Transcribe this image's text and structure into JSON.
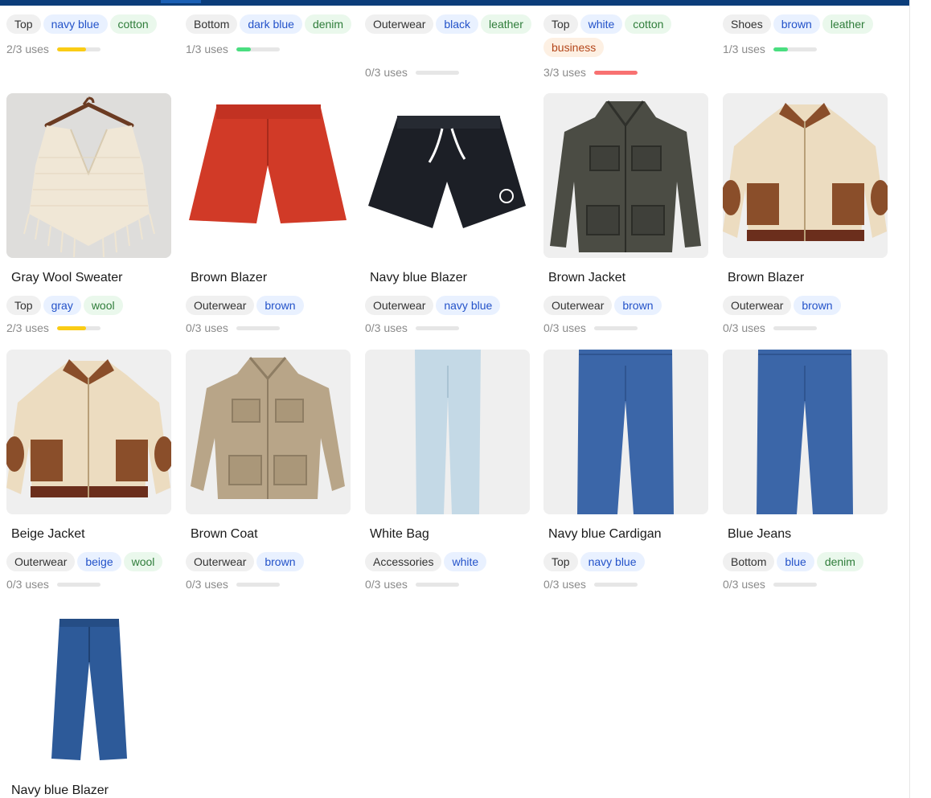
{
  "colors": {
    "bar_empty": "#e6e6e6",
    "bar_one": "#4ade80",
    "bar_two": "#facc15",
    "bar_full": "#f87171"
  },
  "top_row": [
    {
      "tags": [
        {
          "text": "Top",
          "kind": "cat"
        },
        {
          "text": "navy blue",
          "kind": "color"
        },
        {
          "text": "cotton",
          "kind": "mat"
        }
      ],
      "uses": "2/3 uses",
      "used": 2
    },
    {
      "tags": [
        {
          "text": "Bottom",
          "kind": "cat"
        },
        {
          "text": "dark blue",
          "kind": "color"
        },
        {
          "text": "denim",
          "kind": "mat"
        }
      ],
      "uses": "1/3 uses",
      "used": 1
    },
    {
      "tags": [
        {
          "text": "Outerwear",
          "kind": "cat"
        },
        {
          "text": "black",
          "kind": "color"
        },
        {
          "text": "leather",
          "kind": "mat"
        }
      ],
      "uses": "0/3 uses",
      "used": 0
    },
    {
      "tags": [
        {
          "text": "Top",
          "kind": "cat"
        },
        {
          "text": "white",
          "kind": "color"
        },
        {
          "text": "cotton",
          "kind": "mat"
        },
        {
          "text": "business",
          "kind": "occ"
        }
      ],
      "uses": "3/3 uses",
      "used": 3
    },
    {
      "tags": [
        {
          "text": "Shoes",
          "kind": "cat"
        },
        {
          "text": "brown",
          "kind": "color"
        },
        {
          "text": "leather",
          "kind": "mat"
        }
      ],
      "uses": "1/3 uses",
      "used": 1
    }
  ],
  "items": [
    {
      "name": "Gray Wool Sweater",
      "image": "cream-knit-poncho-image",
      "tags": [
        {
          "text": "Top",
          "kind": "cat"
        },
        {
          "text": "gray",
          "kind": "color"
        },
        {
          "text": "wool",
          "kind": "mat"
        }
      ],
      "uses": "2/3 uses",
      "used": 2
    },
    {
      "name": "Brown Blazer",
      "image": "red-shorts-image",
      "tags": [
        {
          "text": "Outerwear",
          "kind": "cat"
        },
        {
          "text": "brown",
          "kind": "color"
        }
      ],
      "uses": "0/3 uses",
      "used": 0
    },
    {
      "name": "Navy blue Blazer",
      "image": "black-shorts-image",
      "tags": [
        {
          "text": "Outerwear",
          "kind": "cat"
        },
        {
          "text": "navy blue",
          "kind": "color"
        }
      ],
      "uses": "0/3 uses",
      "used": 0
    },
    {
      "name": "Brown Jacket",
      "image": "tweed-field-jacket-image",
      "tags": [
        {
          "text": "Outerwear",
          "kind": "cat"
        },
        {
          "text": "brown",
          "kind": "color"
        }
      ],
      "uses": "0/3 uses",
      "used": 0
    },
    {
      "name": "Brown Blazer",
      "image": "beige-suede-bomber-image",
      "tags": [
        {
          "text": "Outerwear",
          "kind": "cat"
        },
        {
          "text": "brown",
          "kind": "color"
        }
      ],
      "uses": "0/3 uses",
      "used": 0
    },
    {
      "name": "Beige Jacket",
      "image": "beige-suede-bomber-image",
      "tags": [
        {
          "text": "Outerwear",
          "kind": "cat"
        },
        {
          "text": "beige",
          "kind": "color"
        },
        {
          "text": "wool",
          "kind": "mat"
        }
      ],
      "uses": "0/3 uses",
      "used": 0
    },
    {
      "name": "Brown Coat",
      "image": "khaki-field-jacket-image",
      "tags": [
        {
          "text": "Outerwear",
          "kind": "cat"
        },
        {
          "text": "brown",
          "kind": "color"
        }
      ],
      "uses": "0/3 uses",
      "used": 0
    },
    {
      "name": "White Bag",
      "image": "light-blue-jeans-image",
      "tags": [
        {
          "text": "Accessories",
          "kind": "cat"
        },
        {
          "text": "white",
          "kind": "color"
        }
      ],
      "uses": "0/3 uses",
      "used": 0
    },
    {
      "name": "Navy blue Cardigan",
      "image": "blue-jeans-image",
      "tags": [
        {
          "text": "Top",
          "kind": "cat"
        },
        {
          "text": "navy blue",
          "kind": "color"
        }
      ],
      "uses": "0/3 uses",
      "used": 0
    },
    {
      "name": "Blue Jeans",
      "image": "blue-jeans-image",
      "tags": [
        {
          "text": "Bottom",
          "kind": "cat"
        },
        {
          "text": "blue",
          "kind": "color"
        },
        {
          "text": "denim",
          "kind": "mat"
        }
      ],
      "uses": "0/3 uses",
      "used": 0
    },
    {
      "name": "Navy blue Blazer",
      "image": "dark-jeans-image",
      "tags": [],
      "uses": "",
      "used": 0
    }
  ]
}
